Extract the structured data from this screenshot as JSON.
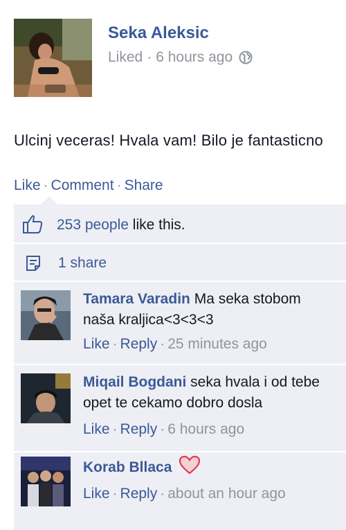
{
  "post": {
    "author": "Seka Aleksic",
    "meta_label": "Liked",
    "meta_time": "6 hours ago",
    "status_text": "Ulcinj veceras! Hvala vam! Bilo je fantasticno",
    "actions": {
      "like": "Like",
      "comment": "Comment",
      "share": "Share"
    },
    "likes_text_link": "253 people",
    "likes_text_rest": " like this.",
    "shares_text": "1 share",
    "icons": {
      "privacy": "globe-icon",
      "likes": "thumbs-up-icon",
      "shares": "share-icon"
    }
  },
  "comments": [
    {
      "author": "Tamara Varadin",
      "line1": "Ma seka stobom",
      "line2": "naša kraljica<3<3<3",
      "like": "Like",
      "reply": "Reply",
      "time": "25 minutes ago"
    },
    {
      "author": "Miqail Bogdani",
      "line1": "seka hvala i od tebe",
      "line2": "opet te cekamo dobro dosla",
      "like": "Like",
      "reply": "Reply",
      "time": "6 hours ago"
    },
    {
      "author": "Korab Bllaca",
      "emoji": "heart-icon",
      "like": "Like",
      "reply": "Reply",
      "time": "about an hour ago"
    }
  ],
  "colors": {
    "link": "#3b5998",
    "muted": "#90949c",
    "panel": "#edeff4",
    "heart": "#e0394f"
  }
}
